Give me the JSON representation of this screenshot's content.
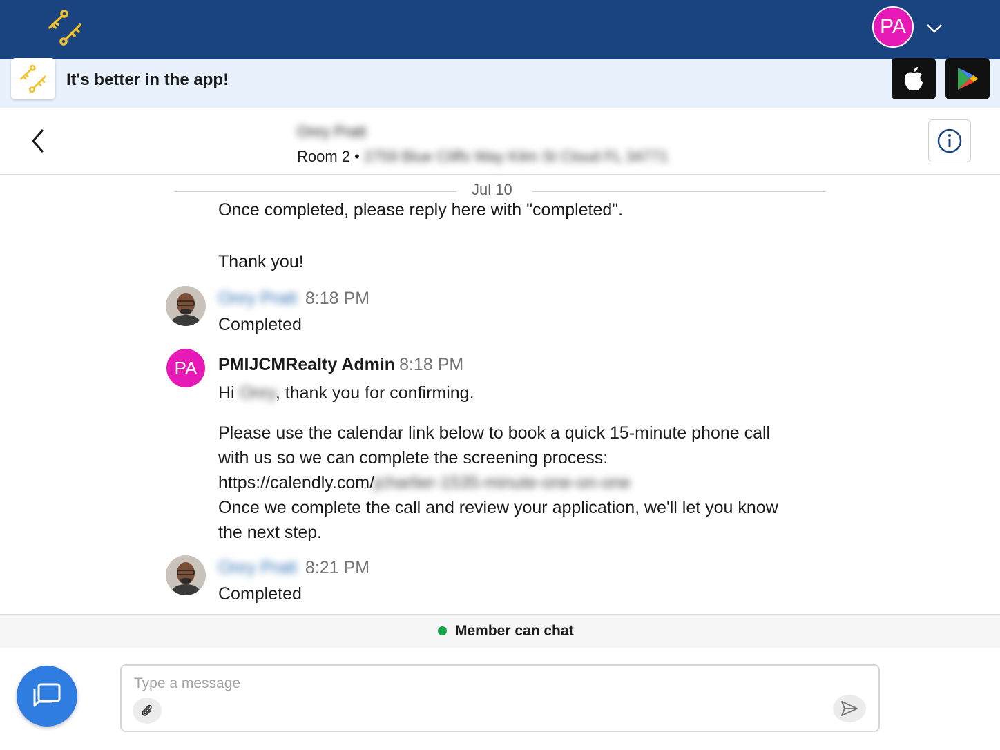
{
  "topbar": {
    "logo_icon": "keys-logo-icon",
    "avatar_initials": "PA",
    "caret_icon": "chevron-down-icon",
    "brand_color": "#1a4480",
    "avatar_color": "#e619b6"
  },
  "banner": {
    "text": "It's better in the app!",
    "apple_icon": "apple-icon",
    "play_icon": "google-play-icon"
  },
  "header": {
    "name": "Onry Pratt",
    "room": "Room 2 •",
    "address": "2759 Blue Cliffs Way Kilm St Cloud FL 34771"
  },
  "date_divider": "Jul 10",
  "messages": {
    "m1": {
      "line1": "Once completed, please reply here with \"completed\".",
      "line2": "Thank you!"
    },
    "m2": {
      "sender": "Onry Pratt",
      "time": "8:18 PM",
      "text": "Completed"
    },
    "m3": {
      "avatar": "PA",
      "sender": "PMIJCMRealty Admin",
      "time": "8:18 PM",
      "hi": "Hi",
      "hi_name": "Onry",
      "hi_rest": ", thank you for confirming.",
      "p1": "Please use the calendar link below to book a quick 15-minute phone call",
      "p2": "with us so we can complete the screening process:",
      "link_prefix": "https://calendly.com/",
      "link_rest": "jcharlier-1535-minute-one-on-one",
      "p3": "Once we complete the call and review your application, we'll let you know",
      "p4": "the next step."
    },
    "m4": {
      "sender": "Onry Pratt",
      "time": "8:21 PM",
      "text": "Completed"
    }
  },
  "status": {
    "text": "Member can chat",
    "color": "#16a34a"
  },
  "composer": {
    "placeholder": "Type a message"
  },
  "fab_icon": "chat-icon"
}
